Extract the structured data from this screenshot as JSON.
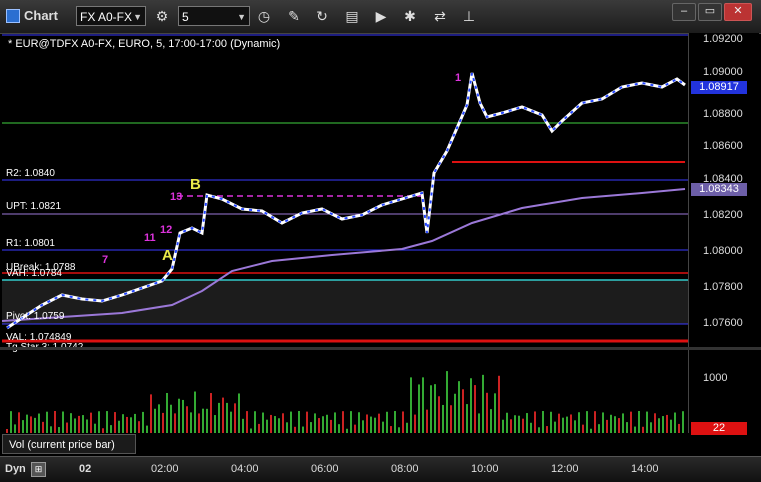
{
  "window": {
    "title": "Chart"
  },
  "toolbar": {
    "symbol_value": "FX A0-FX",
    "interval_value": "5",
    "buttons": [
      "clock-icon",
      "pencil-icon",
      "refresh-icon",
      "gc-icon",
      "play-icon",
      "gear-icon",
      "link-icon",
      "pin-icon"
    ]
  },
  "chart": {
    "title": "* EUR@TDFX A0-FX, EURO, 5, 17:00-17:00 (Dynamic)",
    "price_axis": [
      "1.09200",
      "1.09000",
      "1.08800",
      "1.08600",
      "1.08400",
      "1.08200",
      "1.08000",
      "1.07800",
      "1.07600"
    ],
    "last_price": "1.08917",
    "ma_price": "1.08343",
    "levels": {
      "r2": "R2: 1.0840",
      "upt": "UPT: 1.0821",
      "r1": "R1: 1.0801",
      "ubreak": "UBreak: 1.0788",
      "vah": "VAH: 1.0784",
      "pivot": "Pivot: 1.0759",
      "val": "VAL: 1.074849",
      "tg": "Tg Star 3: 1.0742"
    },
    "annotations": {
      "a": "A",
      "b": "B",
      "n7": "7",
      "n11": "11",
      "n12": "12",
      "n13": "13",
      "n1": "1",
      "right_one": "1",
      "right_one_green": "1."
    },
    "colors": {
      "up": "#ffffff",
      "down": "#2244ff",
      "ma": "#9b78d8",
      "r_line": "#3a3aff"
    }
  },
  "volume": {
    "legend": "Vol (current price bar)",
    "axis": "1000",
    "value": "22"
  },
  "time_axis": {
    "labels": [
      "02",
      "02:00",
      "04:00",
      "06:00",
      "08:00",
      "10:00",
      "12:00",
      "14:00"
    ],
    "dyn": "Dyn"
  }
}
